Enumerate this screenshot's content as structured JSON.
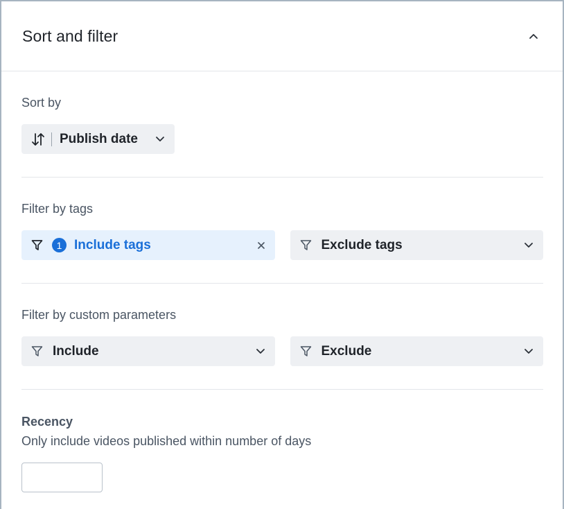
{
  "header": {
    "title": "Sort and filter",
    "collapse_icon": "chevron-up-icon"
  },
  "sort": {
    "label": "Sort by",
    "selected": "Publish date",
    "icon": "sort-arrows-icon"
  },
  "tags": {
    "label": "Filter by tags",
    "include": {
      "label": "Include tags",
      "count": "1",
      "icon": "filter-icon",
      "clear_icon": "close-icon"
    },
    "exclude": {
      "label": "Exclude tags",
      "icon": "filter-icon"
    }
  },
  "params": {
    "label": "Filter by custom parameters",
    "include": {
      "label": "Include",
      "icon": "filter-icon"
    },
    "exclude": {
      "label": "Exclude",
      "icon": "filter-icon"
    }
  },
  "recency": {
    "title": "Recency",
    "description": "Only include videos published within number of days",
    "value": ""
  },
  "colors": {
    "accent": "#1a6fd8",
    "active_bg": "#e6f1fd",
    "pill_bg": "#eef0f3",
    "border": "#a7b4c0"
  }
}
